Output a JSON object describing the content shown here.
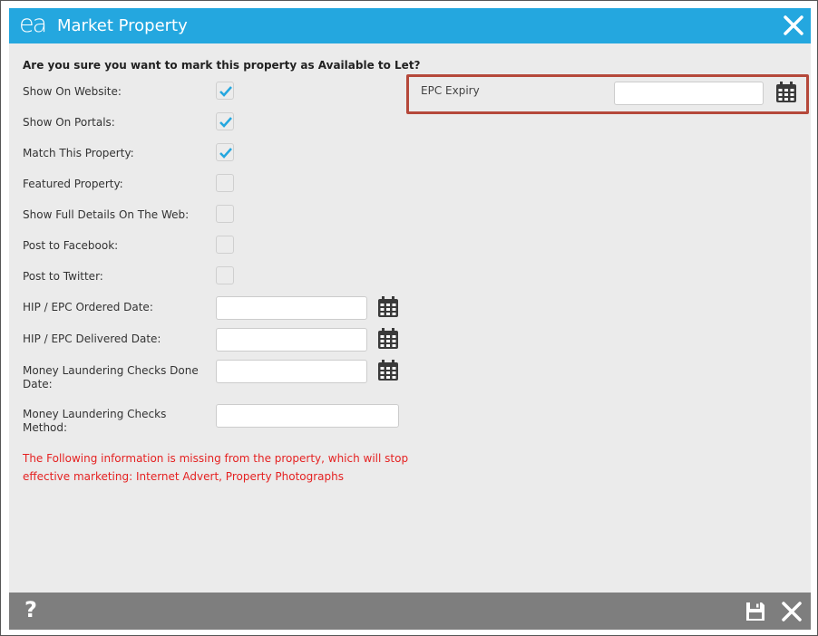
{
  "window": {
    "logo": "ea",
    "title": "Market Property"
  },
  "form": {
    "question": "Are you sure you want to mark this property as Available to Let?",
    "checkboxes": [
      {
        "label": "Show On Website:",
        "checked": true
      },
      {
        "label": "Show On Portals:",
        "checked": true
      },
      {
        "label": "Match This Property:",
        "checked": true
      },
      {
        "label": "Featured Property:",
        "checked": false
      },
      {
        "label": "Show Full Details On The Web:",
        "checked": false
      },
      {
        "label": "Post to Facebook:",
        "checked": false
      },
      {
        "label": "Post to Twitter:",
        "checked": false
      }
    ],
    "date_fields": [
      {
        "label": "HIP / EPC Ordered Date:",
        "value": ""
      },
      {
        "label": "HIP / EPC Delivered Date:",
        "value": ""
      },
      {
        "label": "Money Laundering Checks Done Date:",
        "value": ""
      }
    ],
    "method_field": {
      "label": "Money Laundering Checks Method:",
      "value": ""
    },
    "warning": "The Following information is missing from the property, which will stop effective marketing: Internet Advert, Property Photographs"
  },
  "epc": {
    "label": "EPC Expiry",
    "value": ""
  },
  "footer": {
    "help": "?"
  },
  "colors": {
    "titlebar": "#24a7df",
    "check": "#24a7df",
    "warning": "#e52222",
    "highlight": "#b5483a",
    "footer": "#7e7e7e"
  },
  "icons": [
    "close-icon",
    "calendar-icon",
    "check-icon",
    "save-icon",
    "help-icon"
  ]
}
